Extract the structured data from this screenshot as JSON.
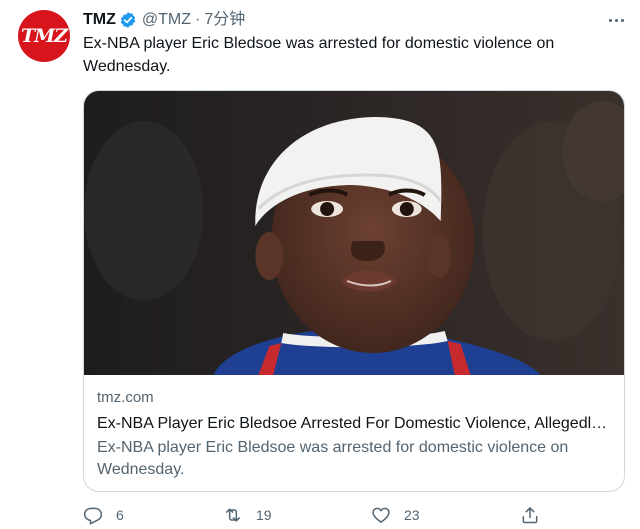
{
  "account": {
    "avatar_text": "TMZ",
    "name": "TMZ",
    "handle": "@TMZ",
    "separator": "·",
    "timestamp": "7分钟"
  },
  "tweet": {
    "text": "Ex-NBA player Eric Bledsoe was arrested for domestic violence on Wednesday."
  },
  "card": {
    "domain": "tmz.com",
    "title": "Ex-NBA Player Eric Bledsoe Arrested For Domestic Violence, Allegedly…",
    "description": "Ex-NBA player Eric Bledsoe was arrested for domestic violence on Wednesday."
  },
  "actions": {
    "reply": {
      "icon": "reply-icon",
      "count": "6"
    },
    "retweet": {
      "icon": "retweet-icon",
      "count": "19"
    },
    "like": {
      "icon": "heart-icon",
      "count": "23"
    },
    "share": {
      "icon": "share-icon"
    }
  },
  "colors": {
    "brand": "#d8141c",
    "verified": "#1d9bf0",
    "secondary_text": "#536471",
    "border": "#cfd9de"
  }
}
